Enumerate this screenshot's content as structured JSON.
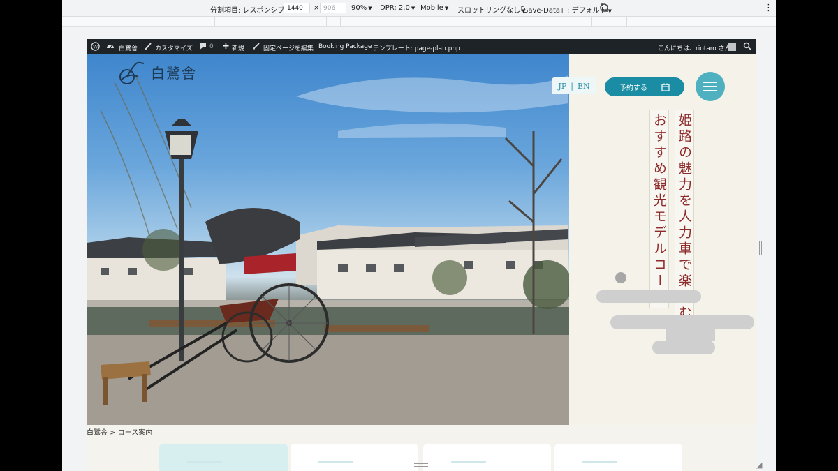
{
  "devtools": {
    "dimensions_label": "分割項目: レスポンシブ",
    "width": "1440",
    "height": "906",
    "times": "×",
    "zoom": "90%",
    "dpr": "DPR: 2.0",
    "mode": "Mobile",
    "throttle": "スロットリングなし",
    "save_data": "「Save-Data」: デフォルト",
    "caret": "▼",
    "more": "⋮"
  },
  "adminbar": {
    "site_name": "白鷺舎",
    "customize": "カスタマイズ",
    "comments_count": "0",
    "new": "新規",
    "edit_page": "固定ページを編集",
    "booking": "Booking Package",
    "template": "テンプレート: page-plan.php",
    "greeting": "こんにちは、riotaro さん"
  },
  "header": {
    "logo_text": "白鷺舎",
    "lang_jp": "JP",
    "lang_sep": "|",
    "lang_en": "EN",
    "reserve_label": "予約する"
  },
  "hero": {
    "title_line1": "姫路の魅力を人力車で楽しむ",
    "title_line2": "おすすめ観光モデルコース"
  },
  "breadcrumb": {
    "text": "白鷺舎 > コース案内"
  },
  "colors": {
    "accent": "#1a8ca3",
    "title": "#8e2a2a",
    "adminbar": "#1d2327"
  }
}
